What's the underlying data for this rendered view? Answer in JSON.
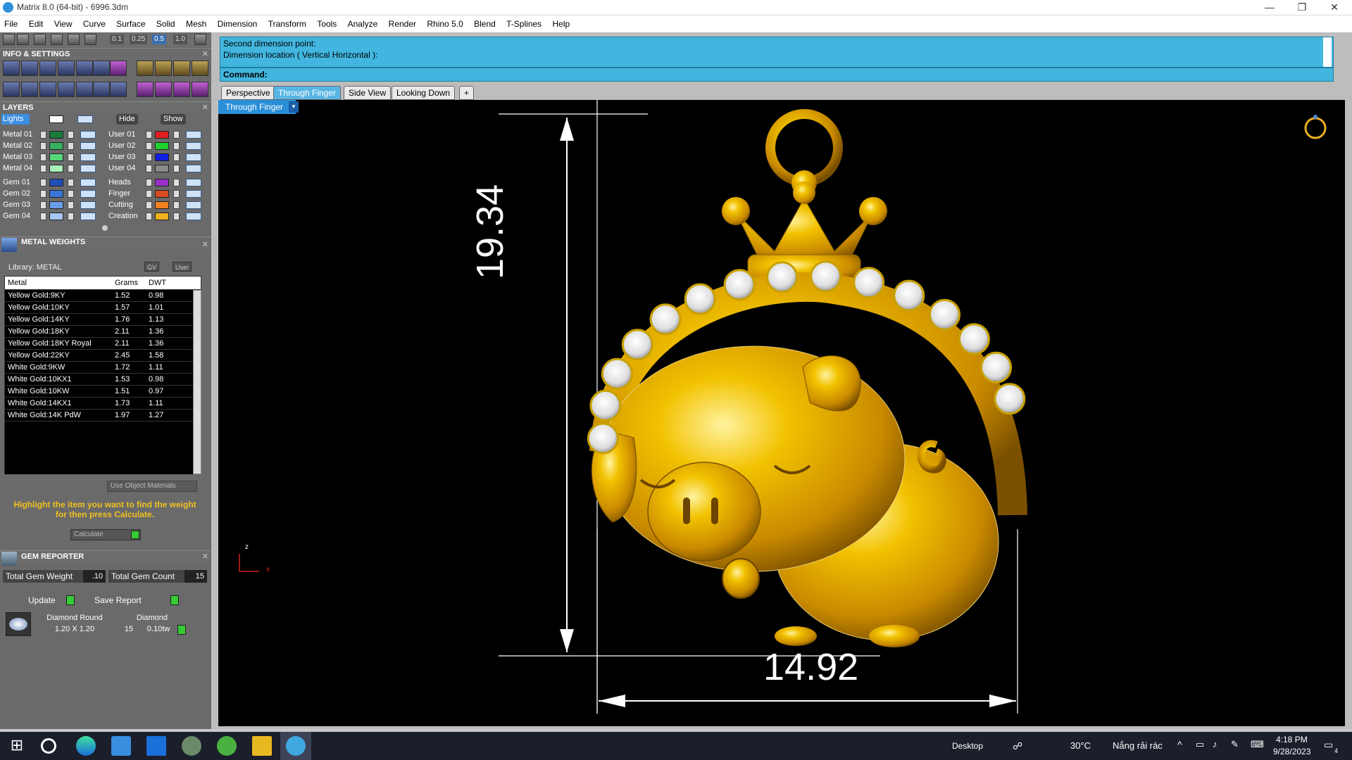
{
  "window": {
    "title": "Matrix 8.0 (64-bit) - 6996.3dm",
    "controls": [
      "—",
      "❐",
      "✕"
    ]
  },
  "menu": [
    "File",
    "Edit",
    "View",
    "Curve",
    "Surface",
    "Solid",
    "Mesh",
    "Dimension",
    "Transform",
    "Tools",
    "Analyze",
    "Render",
    "Rhino 5.0",
    "Blend",
    "T-Splines",
    "Help"
  ],
  "toolbar": {
    "zoom_values": [
      "0.1",
      "0.25",
      "0.5",
      "1.0"
    ]
  },
  "info_settings": {
    "title": "INFO & SETTINGS"
  },
  "layers": {
    "title": "LAYERS",
    "lights_label": "Lights",
    "hide_label": "Hide",
    "show_label": "Show",
    "left": [
      {
        "name": "Metal 01",
        "color": "#1a7a3a"
      },
      {
        "name": "Metal 02",
        "color": "#36b060"
      },
      {
        "name": "Metal 03",
        "color": "#56d878"
      },
      {
        "name": "Metal 04",
        "color": "#a8f0b8"
      },
      {
        "name": "Gem 01",
        "color": "#1f4fb8"
      },
      {
        "name": "Gem 02",
        "color": "#3a76d8"
      },
      {
        "name": "Gem 03",
        "color": "#6a9ee8"
      },
      {
        "name": "Gem 04",
        "color": "#a6c6f4"
      }
    ],
    "right": [
      {
        "name": "User 01",
        "color": "#e02020"
      },
      {
        "name": "User 02",
        "color": "#20d030"
      },
      {
        "name": "User 03",
        "color": "#1020e0"
      },
      {
        "name": "User 04",
        "color": "#8a8a8a"
      },
      {
        "name": "Heads",
        "color": "#9a30c8"
      },
      {
        "name": "Finger",
        "color": "#d84a20"
      },
      {
        "name": "Cutting",
        "color": "#f08020"
      },
      {
        "name": "Creation",
        "color": "#f0b020"
      }
    ]
  },
  "metal_weights": {
    "title": "METAL WEIGHTS",
    "library": "Library: METAL",
    "gv_label": "GV",
    "user_label": "User",
    "columns": [
      "Metal",
      "Grams",
      "DWT"
    ],
    "rows": [
      [
        "Yellow Gold:9KY",
        "1.52",
        "0.98"
      ],
      [
        "Yellow Gold:10KY",
        "1.57",
        "1.01"
      ],
      [
        "Yellow Gold:14KY",
        "1.76",
        "1.13"
      ],
      [
        "Yellow Gold:18KY",
        "2.11",
        "1.36"
      ],
      [
        "Yellow Gold:18KY Royal",
        "2.11",
        "1.36"
      ],
      [
        "Yellow Gold:22KY",
        "2.45",
        "1.58"
      ],
      [
        "White Gold:9KW",
        "1.72",
        "1.11"
      ],
      [
        "White Gold:10KX1",
        "1.53",
        "0.98"
      ],
      [
        "White Gold:10KW",
        "1.51",
        "0.97"
      ],
      [
        "White Gold:14KX1",
        "1.73",
        "1.11"
      ],
      [
        "White Gold:14K PdW",
        "1.97",
        "1.27"
      ]
    ],
    "use_object_materials": "Use Object Materials",
    "hint": "Highlight the item you want to find the weight for then press Calculate.",
    "calculate": "Calculate"
  },
  "gem_reporter": {
    "title": "GEM REPORTER",
    "total_weight_label": "Total Gem Weight",
    "total_weight_value": ".10",
    "total_count_label": "Total Gem Count",
    "total_count_value": "15",
    "update_label": "Update",
    "save_report_label": "Save Report",
    "gem_shape": "Diamond Round",
    "gem_type": "Diamond",
    "gem_size": "1.20 X 1.20",
    "gem_count": "15",
    "gem_weight": "0.10tw"
  },
  "command": {
    "line1": "Second dimension point:",
    "line2": "Dimension location ( Vertical  Horizontal ):",
    "prompt": "Command:"
  },
  "viewport": {
    "tabs": [
      "Perspective",
      "Through Finger",
      "Side View",
      "Looking Down"
    ],
    "add_tab": "+",
    "active_tab": "Through Finger",
    "dropdown_label": "Through Finger",
    "dim_vertical": "19.34",
    "dim_horizontal": "14.92",
    "axis_z": "z",
    "axis_x": "x"
  },
  "taskbar": {
    "desktop_label": "Desktop",
    "temperature": "30°C",
    "weather": "Nắng rải rác",
    "time": "4:18 PM",
    "date": "9/28/2023",
    "notif_count": "4"
  }
}
